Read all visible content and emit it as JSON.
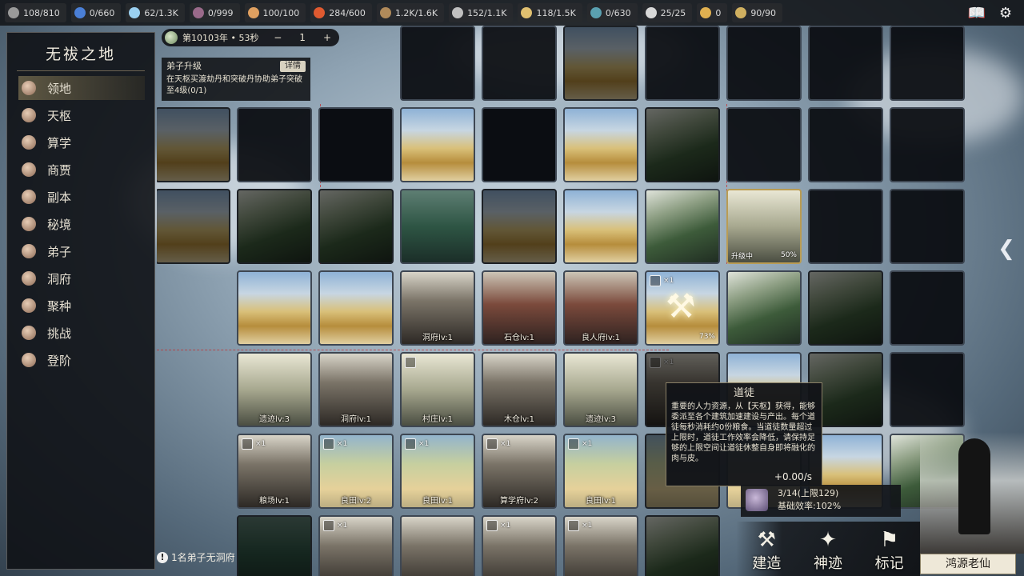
{
  "resources": [
    {
      "icon": "token-icon",
      "value": "108/810",
      "color": "#9a9a9a"
    },
    {
      "icon": "water-drop-icon",
      "value": "0/660",
      "color": "#4a7fd6"
    },
    {
      "icon": "pearl-icon",
      "value": "62/1.3K",
      "color": "#9ad0f0"
    },
    {
      "icon": "figure-icon",
      "value": "0/999",
      "color": "#9a6a8a"
    },
    {
      "icon": "population-icon",
      "value": "100/100",
      "color": "#e0a060"
    },
    {
      "icon": "fire-icon",
      "value": "284/600",
      "color": "#e05a30"
    },
    {
      "icon": "wood-icon",
      "value": "1.2K/1.6K",
      "color": "#b08a5a"
    },
    {
      "icon": "stone-icon",
      "value": "152/1.1K",
      "color": "#c0c0c0"
    },
    {
      "icon": "grain-icon",
      "value": "118/1.5K",
      "color": "#e0c070"
    },
    {
      "icon": "fish-icon",
      "value": "0/630",
      "color": "#5aa0b0"
    },
    {
      "icon": "skull-icon",
      "value": "25/25",
      "color": "#d8d8d8"
    },
    {
      "icon": "gourd-icon",
      "value": "0",
      "color": "#e0b050"
    },
    {
      "icon": "coin-icon",
      "value": "90/90",
      "color": "#d0b060"
    }
  ],
  "top_buttons": [
    "book-icon",
    "gear-icon"
  ],
  "sidebar": {
    "title": "无祓之地",
    "items": [
      {
        "label": "领地",
        "active": true
      },
      {
        "label": "天枢"
      },
      {
        "label": "算学"
      },
      {
        "label": "商贾"
      },
      {
        "label": "副本"
      },
      {
        "label": "秘境"
      },
      {
        "label": "弟子"
      },
      {
        "label": "洞府"
      },
      {
        "label": "聚种"
      },
      {
        "label": "挑战"
      },
      {
        "label": "登阶"
      }
    ],
    "footer": "1名弟子无洞府"
  },
  "time": {
    "label": "第10103年 • 53秒",
    "minus": "−",
    "speed": "1",
    "plus": "+"
  },
  "quest": {
    "title": "弟子升级",
    "button": "详情",
    "desc": "在天枢买渡劫丹和突破丹协助弟子突破至4级(0/1)"
  },
  "tiles": [
    {
      "col": 3,
      "row": 0,
      "kind": "void"
    },
    {
      "col": 4,
      "row": 0,
      "kind": "void"
    },
    {
      "col": 5,
      "row": 0,
      "kind": "desert",
      "dim": true
    },
    {
      "col": 6,
      "row": 0,
      "kind": "void"
    },
    {
      "col": 7,
      "row": 0,
      "kind": "void"
    },
    {
      "col": 8,
      "row": 0,
      "kind": "void"
    },
    {
      "col": 9,
      "row": 0,
      "kind": "void"
    },
    {
      "col": 0,
      "row": 1,
      "kind": "desert",
      "dim": true
    },
    {
      "col": 1,
      "row": 1,
      "kind": "void"
    },
    {
      "col": 2,
      "row": 1,
      "kind": "dark"
    },
    {
      "col": 3,
      "row": 1,
      "kind": "desert"
    },
    {
      "col": 4,
      "row": 1,
      "kind": "dark"
    },
    {
      "col": 5,
      "row": 1,
      "kind": "desert"
    },
    {
      "col": 6,
      "row": 1,
      "kind": "tree",
      "dim": true
    },
    {
      "col": 7,
      "row": 1,
      "kind": "void"
    },
    {
      "col": 8,
      "row": 1,
      "kind": "void"
    },
    {
      "col": 9,
      "row": 1,
      "kind": "void"
    },
    {
      "col": 0,
      "row": 2,
      "kind": "desert",
      "dim": true
    },
    {
      "col": 1,
      "row": 2,
      "kind": "tree",
      "dim": true
    },
    {
      "col": 2,
      "row": 2,
      "kind": "tree",
      "dim": true
    },
    {
      "col": 3,
      "row": 2,
      "kind": "forest"
    },
    {
      "col": 4,
      "row": 2,
      "kind": "desert",
      "dim": true
    },
    {
      "col": 5,
      "row": 2,
      "kind": "desert"
    },
    {
      "col": 6,
      "row": 2,
      "kind": "tree"
    },
    {
      "col": 7,
      "row": 2,
      "kind": "sketch",
      "label": "升级中",
      "progress": "50%",
      "sel": true
    },
    {
      "col": 8,
      "row": 2,
      "kind": "void"
    },
    {
      "col": 9,
      "row": 2,
      "kind": "void"
    },
    {
      "col": 1,
      "row": 3,
      "kind": "desert"
    },
    {
      "col": 2,
      "row": 3,
      "kind": "desert"
    },
    {
      "col": 3,
      "row": 3,
      "kind": "bldg",
      "label": "洞府lv:1"
    },
    {
      "col": 4,
      "row": 3,
      "kind": "bldg-red",
      "label": "石仓lv:1"
    },
    {
      "col": 5,
      "row": 3,
      "kind": "bldg-red",
      "label": "良人府lv:1"
    },
    {
      "col": 6,
      "row": 3,
      "kind": "desert",
      "badge": "×1",
      "hammer": true,
      "progress": "73%"
    },
    {
      "col": 7,
      "row": 3,
      "kind": "tree"
    },
    {
      "col": 8,
      "row": 3,
      "kind": "tree",
      "dim": true
    },
    {
      "col": 9,
      "row": 3,
      "kind": "void"
    },
    {
      "col": 1,
      "row": 4,
      "kind": "sketch",
      "label": "遗迹lv:3"
    },
    {
      "col": 2,
      "row": 4,
      "kind": "bldg",
      "label": "洞府lv:1"
    },
    {
      "col": 3,
      "row": 4,
      "kind": "sketch",
      "label": "村庄lv:1",
      "badge": ""
    },
    {
      "col": 4,
      "row": 4,
      "kind": "bldg",
      "label": "木仓lv:1"
    },
    {
      "col": 5,
      "row": 4,
      "kind": "sketch",
      "label": "遗迹lv:3"
    },
    {
      "col": 6,
      "row": 4,
      "kind": "bldg",
      "badge": "×1",
      "dim": true
    },
    {
      "col": 7,
      "row": 4,
      "kind": "desert"
    },
    {
      "col": 8,
      "row": 4,
      "kind": "tree",
      "dim": true
    },
    {
      "col": 9,
      "row": 4,
      "kind": "void"
    },
    {
      "col": 1,
      "row": 5,
      "kind": "bldg",
      "label": "粮场lv:1",
      "badge": "×1"
    },
    {
      "col": 2,
      "row": 5,
      "kind": "field",
      "label": "良田lv:2",
      "badge": "×1"
    },
    {
      "col": 3,
      "row": 5,
      "kind": "field",
      "label": "良田lv:1",
      "badge": "×1"
    },
    {
      "col": 4,
      "row": 5,
      "kind": "bldg",
      "label": "算学府lv:2",
      "badge": "×1"
    },
    {
      "col": 5,
      "row": 5,
      "kind": "field",
      "label": "良田lv:1",
      "badge": "×1"
    },
    {
      "col": 6,
      "row": 5,
      "kind": "field",
      "dim": true
    },
    {
      "col": 7,
      "row": 5,
      "kind": "field"
    },
    {
      "col": 8,
      "row": 5,
      "kind": "desert"
    },
    {
      "col": 9,
      "row": 5,
      "kind": "tree"
    },
    {
      "col": 1,
      "row": 6,
      "kind": "forest",
      "dim": true
    },
    {
      "col": 2,
      "row": 6,
      "kind": "bldg",
      "badge": "×1"
    },
    {
      "col": 3,
      "row": 6,
      "kind": "bldg"
    },
    {
      "col": 4,
      "row": 6,
      "kind": "bldg",
      "badge": "×1"
    },
    {
      "col": 5,
      "row": 6,
      "kind": "bldg",
      "badge": "×1"
    },
    {
      "col": 6,
      "row": 6,
      "kind": "tree",
      "dim": true
    }
  ],
  "tooltip": {
    "title": "道徒",
    "body": "重要的人力资源，从【天枢】获得，能够委派至各个建筑加速建设与产出。每个道徒每秒消耗约0份粮食。当道徒数量超过上限时，道徒工作效率会降低，请保持足够的上限空间让道徒休整自身即将融化的肉与皮。",
    "rate": "+0.00/s"
  },
  "worker": {
    "count": "3/14(上限129)",
    "efficiency": "基础效率:102%"
  },
  "actions": [
    {
      "icon": "hammer-icon",
      "label": "建造"
    },
    {
      "icon": "feather-icon",
      "label": "神迹"
    },
    {
      "icon": "flag-icon",
      "label": "标记"
    }
  ],
  "character": {
    "name": "鸿源老仙"
  }
}
